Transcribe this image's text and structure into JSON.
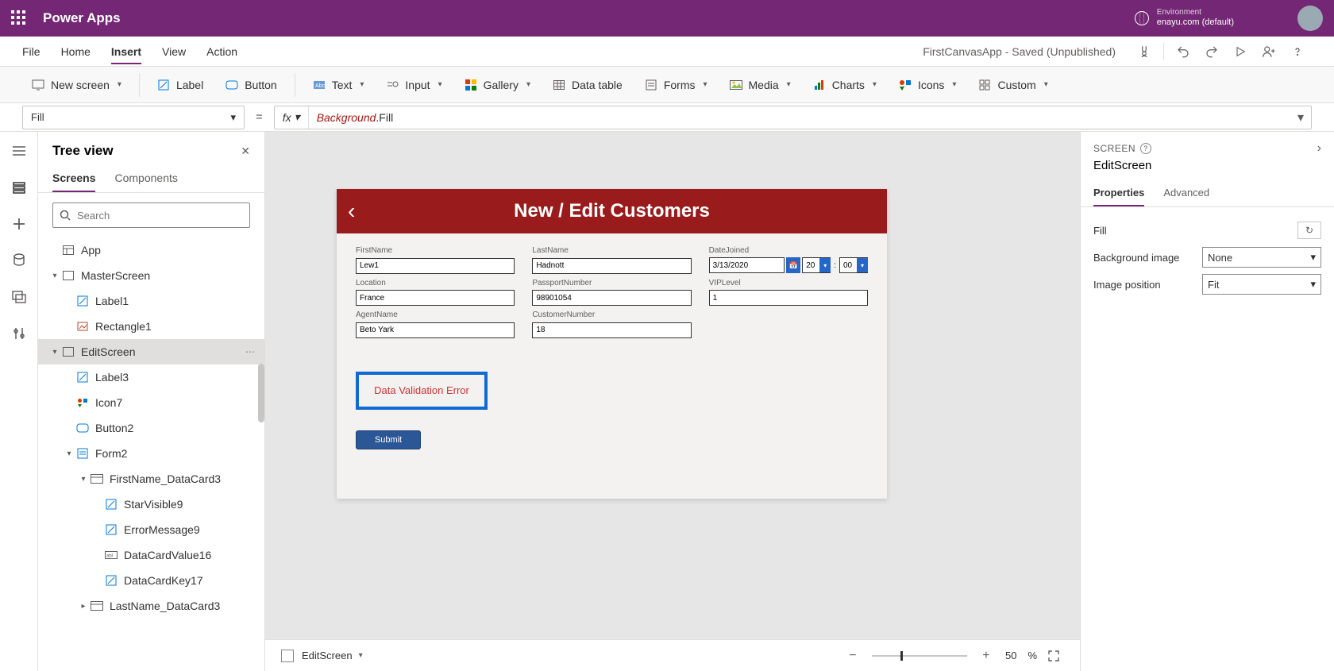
{
  "header": {
    "app_title": "Power Apps",
    "env_label": "Environment",
    "env_value": "enayu.com (default)"
  },
  "menu": {
    "items": [
      "File",
      "Home",
      "Insert",
      "View",
      "Action"
    ],
    "active_index": 2,
    "doc_title": "FirstCanvasApp - Saved (Unpublished)"
  },
  "ribbon": {
    "new_screen": "New screen",
    "label": "Label",
    "button": "Button",
    "text": "Text",
    "input": "Input",
    "gallery": "Gallery",
    "data_table": "Data table",
    "forms": "Forms",
    "media": "Media",
    "charts": "Charts",
    "icons": "Icons",
    "custom": "Custom"
  },
  "formula": {
    "property": "Fill",
    "kw": "Background",
    "rest": ".Fill"
  },
  "tree": {
    "title": "Tree view",
    "tabs": [
      "Screens",
      "Components"
    ],
    "search_placeholder": "Search",
    "nodes": [
      {
        "depth": 0,
        "chev": "",
        "icon": "layout",
        "label": "App"
      },
      {
        "depth": 0,
        "chev": "▾",
        "icon": "screen",
        "label": "MasterScreen"
      },
      {
        "depth": 1,
        "chev": "",
        "icon": "label",
        "label": "Label1"
      },
      {
        "depth": 1,
        "chev": "",
        "icon": "rect",
        "label": "Rectangle1"
      },
      {
        "depth": 0,
        "chev": "▾",
        "icon": "screen",
        "label": "EditScreen",
        "selected": true,
        "more": true
      },
      {
        "depth": 1,
        "chev": "",
        "icon": "label",
        "label": "Label3"
      },
      {
        "depth": 1,
        "chev": "",
        "icon": "icons",
        "label": "Icon7"
      },
      {
        "depth": 1,
        "chev": "",
        "icon": "button",
        "label": "Button2"
      },
      {
        "depth": 1,
        "chev": "▾",
        "icon": "form",
        "label": "Form2"
      },
      {
        "depth": 2,
        "chev": "▾",
        "icon": "card",
        "label": "FirstName_DataCard3"
      },
      {
        "depth": 3,
        "chev": "",
        "icon": "label",
        "label": "StarVisible9"
      },
      {
        "depth": 3,
        "chev": "",
        "icon": "label",
        "label": "ErrorMessage9"
      },
      {
        "depth": 3,
        "chev": "",
        "icon": "input",
        "label": "DataCardValue16"
      },
      {
        "depth": 3,
        "chev": "",
        "icon": "label",
        "label": "DataCardKey17"
      },
      {
        "depth": 2,
        "chev": "▸",
        "icon": "card",
        "label": "LastName_DataCard3"
      }
    ]
  },
  "canvas": {
    "title": "New / Edit Customers",
    "fields": {
      "firstname": {
        "label": "FirstName",
        "value": "Lew1"
      },
      "lastname": {
        "label": "LastName",
        "value": "Hadnott"
      },
      "datejoined": {
        "label": "DateJoined",
        "value": "3/13/2020",
        "hh": "20",
        "mm": "00"
      },
      "location": {
        "label": "Location",
        "value": "France"
      },
      "passport": {
        "label": "PassportNumber",
        "value": "98901054"
      },
      "vip": {
        "label": "VIPLevel",
        "value": "1"
      },
      "agent": {
        "label": "AgentName",
        "value": "Beto Yark"
      },
      "custnum": {
        "label": "CustomerNumber",
        "value": "18"
      }
    },
    "error_label": "Data Validation Error",
    "submit_label": "Submit"
  },
  "bottom": {
    "screen": "EditScreen",
    "zoom": "50",
    "pct": "%"
  },
  "props": {
    "type": "SCREEN",
    "name": "EditScreen",
    "tabs": [
      "Properties",
      "Advanced"
    ],
    "rows": {
      "fill": "Fill",
      "bgimg": "Background image",
      "bgimg_val": "None",
      "imgpos": "Image position",
      "imgpos_val": "Fit"
    }
  }
}
